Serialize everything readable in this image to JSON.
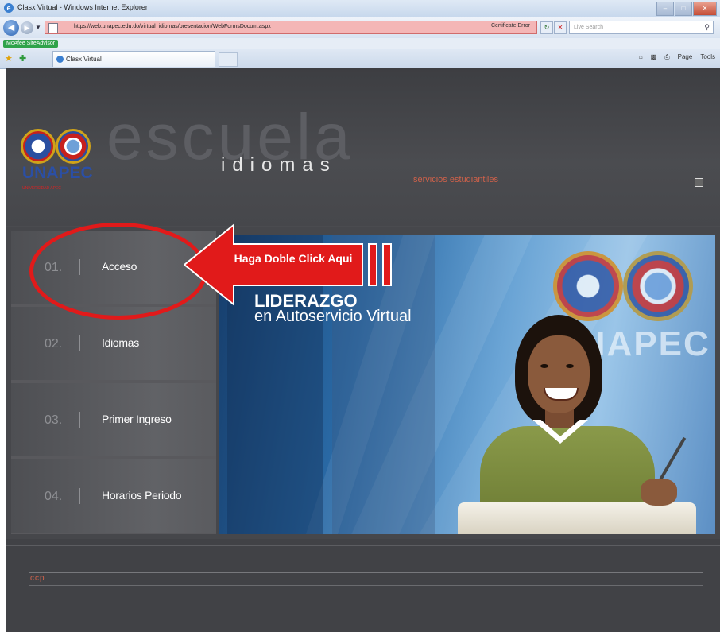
{
  "browser": {
    "window_title": "Clasx Virtual - Windows Internet Explorer",
    "url": "https://web.unapec.edu.do/virtual_idiomas/presentacion/WebFormsDocum.aspx",
    "certificate_error": "Certificate Error",
    "search_placeholder": "Live Search",
    "toolbar_badge": "McAfee SiteAdvisor",
    "tab_title": "Clasx Virtual",
    "commands": [
      "Page",
      "Tools"
    ]
  },
  "header": {
    "logo_text": "UNAPEC",
    "logo_subtext": "UNIVERSIDAD APEC",
    "escuela": "escuela",
    "idiomas": "idiomas",
    "servicios_link": "servicios estudiantiles"
  },
  "menu": {
    "items": [
      {
        "num": "01.",
        "label": "Acceso"
      },
      {
        "num": "02.",
        "label": "Idiomas"
      },
      {
        "num": "03.",
        "label": "Primer Ingreso"
      },
      {
        "num": "04.",
        "label": "Horarios Periodo"
      }
    ]
  },
  "banner": {
    "title": "LIDERAZGO",
    "subtitle": "en Autoservicio Virtual",
    "logo_text": "UNAPEC"
  },
  "callout": {
    "text": "Haga Doble Click Aqui"
  },
  "footer": {
    "code": "ccp"
  },
  "colors": {
    "page_bg": "#4a4b4f",
    "accent_orange": "#d0614a",
    "callout_red": "#e11a1a"
  }
}
